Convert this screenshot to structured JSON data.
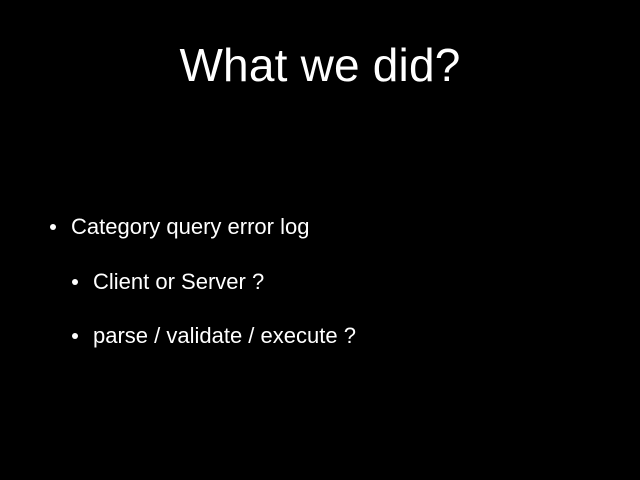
{
  "slide": {
    "title": "What we did?",
    "bullets": [
      {
        "text": "Category query error log"
      },
      {
        "text": "Client or Server ?"
      },
      {
        "text": "parse / validate / execute ?"
      }
    ]
  },
  "colors": {
    "background": "#000000",
    "text": "#ffffff"
  }
}
